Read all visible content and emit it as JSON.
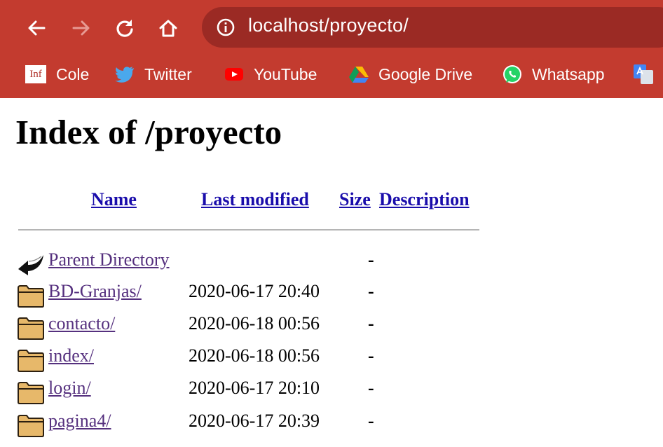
{
  "browser": {
    "url": "localhost/proyecto/",
    "bookmarks": [
      {
        "label": "Cole",
        "icon": "inf-logo-icon",
        "icon_text": "Inf"
      },
      {
        "label": "Twitter",
        "icon": "twitter-bird-icon"
      },
      {
        "label": "YouTube",
        "icon": "youtube-play-icon"
      },
      {
        "label": "Google Drive",
        "icon": "google-drive-icon"
      },
      {
        "label": "Whatsapp",
        "icon": "whatsapp-icon"
      }
    ],
    "colors": {
      "chrome": "#c33b2f",
      "omnibox": "#9b2a24"
    }
  },
  "page": {
    "title": "Index of /proyecto",
    "columns": {
      "name": "Name",
      "last_modified": "Last modified",
      "size": "Size",
      "description": "Description"
    },
    "entries": [
      {
        "name": "Parent Directory",
        "modified": "",
        "size": "-",
        "icon": "back-arrow-icon"
      },
      {
        "name": "BD-Granjas/",
        "modified": "2020-06-17 20:40",
        "size": "-",
        "icon": "folder-icon"
      },
      {
        "name": "contacto/",
        "modified": "2020-06-18 00:56",
        "size": "-",
        "icon": "folder-icon"
      },
      {
        "name": "index/",
        "modified": "2020-06-18 00:56",
        "size": "-",
        "icon": "folder-icon"
      },
      {
        "name": "login/",
        "modified": "2020-06-17 20:10",
        "size": "-",
        "icon": "folder-icon"
      },
      {
        "name": "pagina4/",
        "modified": "2020-06-17 20:39",
        "size": "-",
        "icon": "folder-icon"
      }
    ],
    "colors": {
      "link": "#1a0dab",
      "visited": "#55307e"
    }
  }
}
